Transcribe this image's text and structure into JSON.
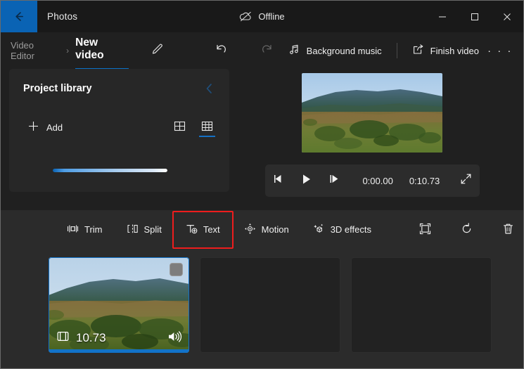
{
  "titlebar": {
    "back_icon": "back-arrow-icon",
    "app_name": "Photos",
    "status_icon": "cloud-offline-icon",
    "status_label": "Offline",
    "minimize_label": "Minimize",
    "maximize_label": "Maximize",
    "close_label": "Close",
    "accent_color": "#0a63b4"
  },
  "commandbar": {
    "breadcrumb_parent": "Video Editor",
    "breadcrumb_separator": "›",
    "breadcrumb_current": "New video",
    "rename_icon": "pencil-icon",
    "undo_icon": "undo-icon",
    "redo_icon": "redo-icon",
    "background_music_icon": "music-note-icon",
    "background_music_label": "Background music",
    "finish_video_icon": "share-export-icon",
    "finish_video_label": "Finish video",
    "more_label": "· · ·",
    "underline_color": "#0a72c7"
  },
  "library": {
    "title": "Project library",
    "collapse_icon": "chevron-left-icon",
    "add_icon": "plus-icon",
    "add_label": "Add",
    "view_large_icon": "grid-2x2-icon",
    "view_small_icon": "grid-3x3-icon",
    "active_view": "grid-3x3-icon",
    "progress_percent": 100
  },
  "preview": {
    "thumbnail_alt": "landscape-video-frame",
    "prev_frame_icon": "previous-frame-icon",
    "play_icon": "play-icon",
    "next_frame_icon": "next-frame-icon",
    "current_time": "0:00.00",
    "total_time": "0:10.73",
    "fullscreen_icon": "fullscreen-icon"
  },
  "clip_toolbar": {
    "items": [
      {
        "icon": "trim-icon",
        "label": "Trim"
      },
      {
        "icon": "split-icon",
        "label": "Split"
      },
      {
        "icon": "text-icon",
        "label": "Text"
      },
      {
        "icon": "motion-icon",
        "label": "Motion"
      },
      {
        "icon": "3d-effects-icon",
        "label": "3D effects"
      }
    ],
    "icon_only": [
      {
        "icon": "filters-icon"
      },
      {
        "icon": "rotate-icon"
      },
      {
        "icon": "delete-icon"
      }
    ],
    "more_label": "· · ·",
    "highlighted_item": "Text",
    "highlight_color": "#ee1d1d"
  },
  "storyboard": {
    "clips": [
      {
        "state": "filled",
        "selected": true,
        "checkbox_checked": false,
        "duration_icon": "film-icon",
        "duration": "10.73",
        "volume_icon": "volume-icon"
      },
      {
        "state": "empty",
        "selected": false
      },
      {
        "state": "empty",
        "selected": false
      }
    ],
    "selection_color": "#1272c8"
  }
}
